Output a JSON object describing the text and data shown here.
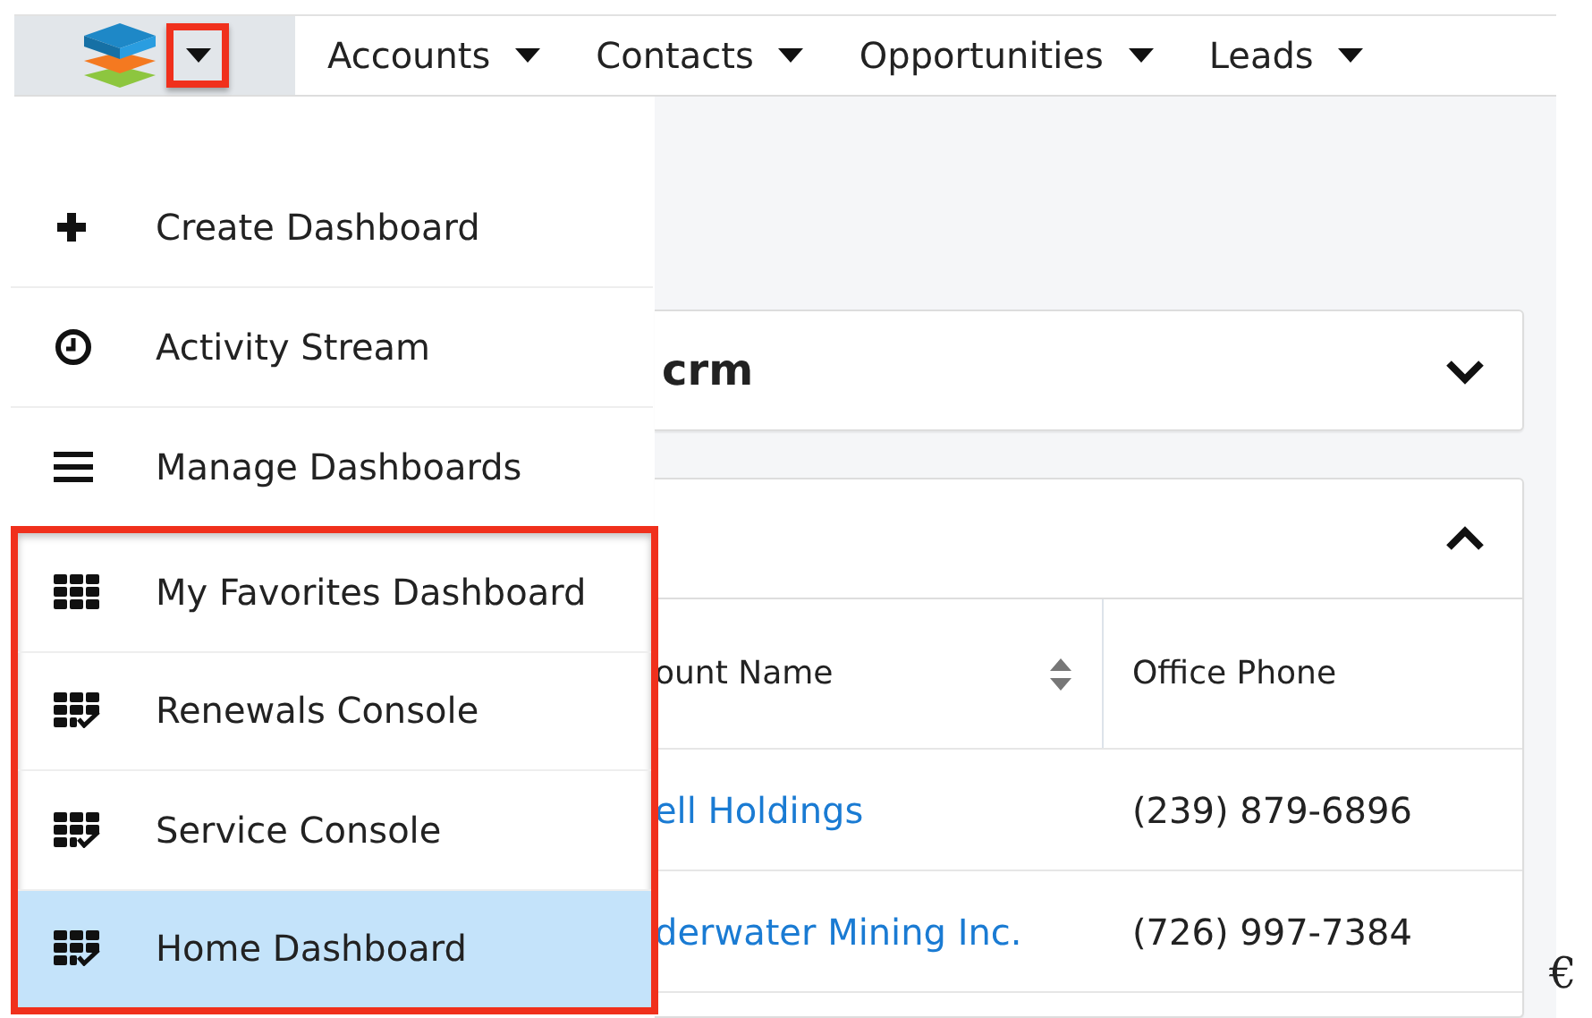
{
  "logo_menu": {
    "highlighted": true
  },
  "nav": [
    {
      "label": "Accounts"
    },
    {
      "label": "Contacts"
    },
    {
      "label": "Opportunities"
    },
    {
      "label": "Leads"
    }
  ],
  "dropdown": {
    "sections": [
      {
        "highlighted": false,
        "items": [
          {
            "kind": "plus",
            "label": "Create Dashboard",
            "selected": false
          },
          {
            "kind": "clock",
            "label": "Activity Stream",
            "selected": false
          },
          {
            "kind": "bars",
            "label": "Manage Dashboards",
            "selected": false
          }
        ]
      },
      {
        "highlighted": true,
        "items": [
          {
            "kind": "grid",
            "label": "My Favorites Dashboard",
            "selected": false
          },
          {
            "kind": "grid-check",
            "label": "Renewals Console",
            "selected": false
          },
          {
            "kind": "grid-check",
            "label": "Service Console",
            "selected": false
          },
          {
            "kind": "grid-check",
            "label": "Home Dashboard",
            "selected": true
          }
        ]
      }
    ]
  },
  "dashlet_1": {
    "title": "crm",
    "expanded": false
  },
  "dashlet_2": {
    "expanded": true,
    "table": {
      "columns": [
        {
          "label": "ount Name",
          "sortable": true
        },
        {
          "label": "Office Phone",
          "sortable": false
        }
      ],
      "rows": [
        [
          "ell Holdings",
          "(239) 879-6896"
        ],
        [
          "derwater Mining Inc.",
          "(726) 997-7384"
        ]
      ]
    }
  },
  "stray_mark": "€"
}
